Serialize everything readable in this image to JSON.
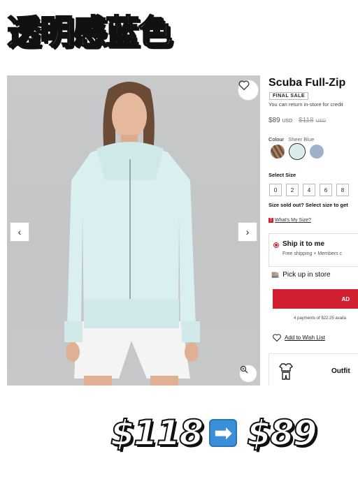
{
  "headline": "透明感蓝色",
  "product": {
    "title": "Scuba Full-Zip",
    "badge": "FINAL SALE",
    "return_note": "You can return in-store for credit",
    "price": "$89",
    "price_currency": "USD",
    "old_price": "$118",
    "old_currency": "USD",
    "colour_label": "Colour",
    "colour_value": "Sheer Blue",
    "swatches": [
      {
        "name": "brown-pattern",
        "color": "#8a6a52"
      },
      {
        "name": "sheer-blue",
        "color": "#d9ecec",
        "selected": true
      },
      {
        "name": "denim-blue",
        "color": "#9fb1c9"
      }
    ],
    "size_label": "Select Size",
    "sizes": [
      "0",
      "2",
      "4",
      "6",
      "8"
    ],
    "sold_out_note": "Size sold out? Select size to get",
    "my_size_link": "What's My Size?",
    "ship_title": "Ship it to me",
    "ship_sub": "Free shipping + Members c",
    "pickup_label": "Pick up in store",
    "add_label": "AD",
    "payments_note": "4 payments of $22.25 availa",
    "wishlist_label": "Add to Wish List",
    "outfit_label": "Outfit"
  },
  "comparison": {
    "before": "$118",
    "after": "$89",
    "arrow": "➡"
  },
  "colors": {
    "accent_red": "#d22030",
    "arrow_blue": "#3b8fd9",
    "jacket": "#d9eff0"
  }
}
